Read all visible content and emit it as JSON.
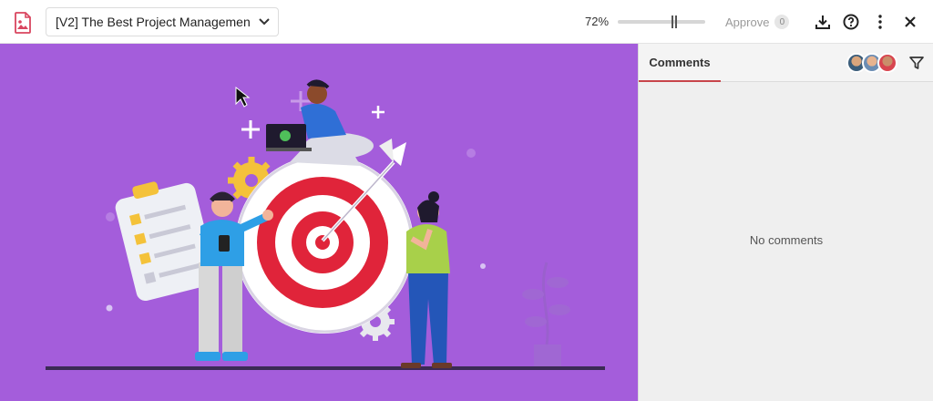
{
  "header": {
    "title": "[V2] The Best Project Managemen",
    "zoom": "72%",
    "zoom_level": 0.72,
    "approve_label": "Approve",
    "approve_count": "0"
  },
  "icons": {
    "logo": "document-image-icon",
    "dropdown": "chevron-down-icon",
    "download": "download-icon",
    "help": "help-icon",
    "more": "more-vertical-icon",
    "close": "close-icon",
    "filter": "filter-icon",
    "cursor": "cursor-arrow-icon"
  },
  "comments_panel": {
    "tab_label": "Comments",
    "empty_message": "No comments",
    "avatars": [
      "avatar-1",
      "avatar-2",
      "avatar-3"
    ]
  },
  "colors": {
    "canvas_bg": "#a45ddb",
    "accent": "#c8454b",
    "target_red": "#e0243a",
    "logo": "#d9455f"
  }
}
